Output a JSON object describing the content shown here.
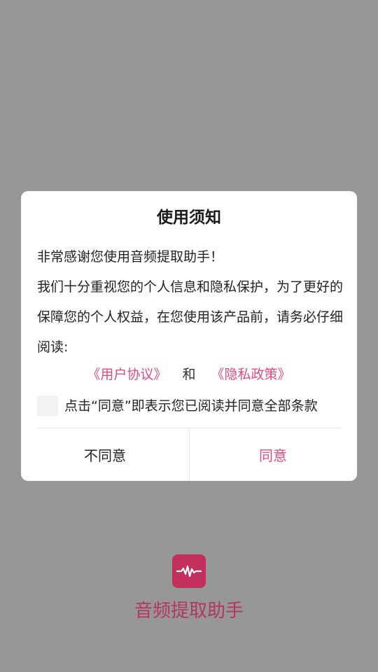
{
  "dialog": {
    "title": "使用须知",
    "paragraphs": [
      "非常感谢您使用音频提取助手！",
      "我们十分重视您的个人信息和隐私保护，为了更好的保障您的个人权益，在您使用该产品前，请务必仔细阅读:"
    ],
    "user_agreement_link": "《用户协议》",
    "and_text": "和",
    "privacy_policy_link": "《隐私政策》",
    "consent_text": "点击“同意”即表示您已阅读并同意全部条款",
    "disagree_label": "不同意",
    "agree_label": "同意"
  },
  "app": {
    "name": "音频提取助手",
    "icon": "audio-waveform-icon"
  },
  "colors": {
    "overlay": "#979797",
    "accent": "#e14b7b",
    "icon_bg": "#c42f5c",
    "app_name": "#b4365c"
  }
}
